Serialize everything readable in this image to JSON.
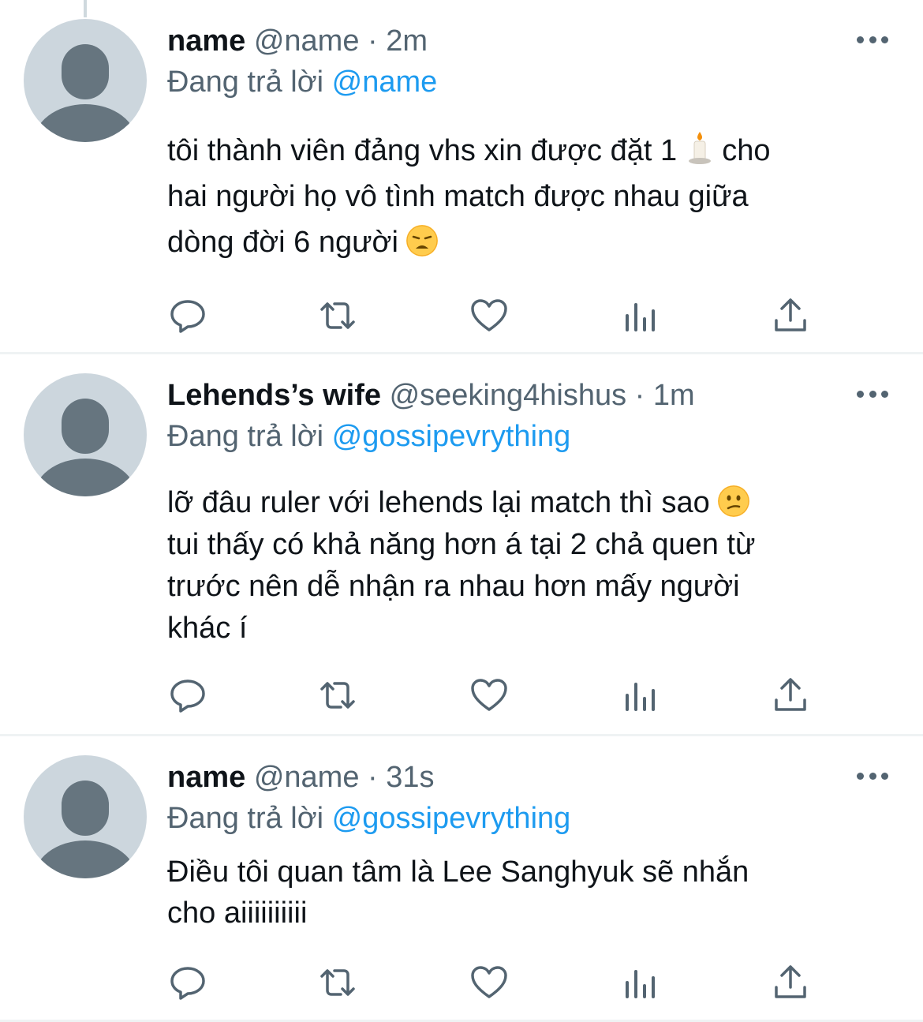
{
  "colors": {
    "text": "#0f1419",
    "secondary": "#536471",
    "link": "#1d9bf0",
    "avatar_bg": "#ccd6dd",
    "avatar_fg": "#66757f",
    "divider": "#eff3f4"
  },
  "icons": [
    "default-avatar-icon",
    "more-icon",
    "reply-icon",
    "retweet-icon",
    "like-icon",
    "analytics-icon",
    "share-icon",
    "candle-emoji",
    "weary-face-emoji",
    "confused-face-emoji"
  ],
  "tweets": [
    {
      "display_name": "name",
      "handle": "@name",
      "separator": "·",
      "time": "2m",
      "reply_prefix": "Đang trả lời",
      "reply_to": "@name",
      "text_a": "tôi thành viên đảng vhs xin được đặt 1 ",
      "text_b": " cho\nhai người họ vô tình match được nhau giữa\ndòng đời 6 người "
    },
    {
      "display_name": "Lehends’s wife",
      "handle": "@seeking4hishus",
      "separator": "·",
      "time": "1m",
      "reply_prefix": "Đang trả lời",
      "reply_to": "@gossipevrything",
      "text_a": "lỡ đâu ruler với lehends lại match thì sao ",
      "text_b": "\ntui thấy có khả năng hơn á tại 2 chả quen từ\ntrước nên dễ nhận ra nhau hơn mấy người\nkhác í"
    },
    {
      "display_name": "name",
      "handle": "@name",
      "separator": "·",
      "time": "31s",
      "reply_prefix": "Đang trả lời",
      "reply_to": "@gossipevrything",
      "text_a": "Điều tôi quan tâm là Lee Sanghyuk sẽ nhắn\ncho aiiiiiiiiii"
    }
  ]
}
